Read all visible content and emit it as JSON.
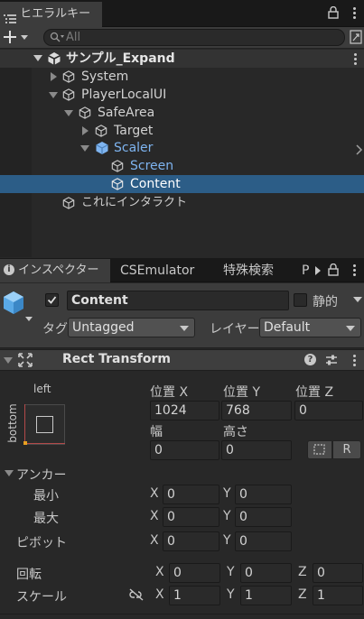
{
  "hierarchy": {
    "tab_label": "ヒエラルキー",
    "search_placeholder": "All",
    "scene_name": "サンプル_Expand",
    "items": [
      {
        "label": "System"
      },
      {
        "label": "PlayerLocalUI"
      },
      {
        "label": "SafeArea"
      },
      {
        "label": "Target"
      },
      {
        "label": "Scaler"
      },
      {
        "label": "Screen"
      },
      {
        "label": "Content"
      },
      {
        "label": "これにインタラクト"
      }
    ]
  },
  "inspector": {
    "tabs": [
      {
        "label": "インスペクター"
      },
      {
        "label": "CSEmulator"
      },
      {
        "label": "特殊検索"
      },
      {
        "label": "P"
      }
    ],
    "object_name": "Content",
    "static_label": "静的",
    "tag_label": "タグ",
    "tag_value": "Untagged",
    "layer_label": "レイヤー",
    "layer_value": "Default",
    "component_title": "Rect Transform",
    "anchor_preset": {
      "top_label": "left",
      "side_label": "bottom"
    },
    "pos_labels": [
      "位置 X",
      "位置 Y",
      "位置 Z"
    ],
    "pos_values": [
      "1024",
      "768",
      "0"
    ],
    "width_label": "幅",
    "height_label": "高さ",
    "width_value": "0",
    "height_value": "0",
    "r_button": "R",
    "anchors_label": "アンカー",
    "min_label": "最小",
    "max_label": "最大",
    "pivot_label": "ピボット",
    "rotation_label": "回転",
    "scale_label": "スケール",
    "axis_x": "X",
    "axis_y": "Y",
    "axis_z": "Z",
    "anchor_min": [
      "0",
      "0"
    ],
    "anchor_max": [
      "0",
      "0"
    ],
    "pivot": [
      "0",
      "0"
    ],
    "rotation": [
      "0",
      "0",
      "0"
    ],
    "scale": [
      "1",
      "1",
      "1"
    ]
  },
  "colors": {
    "selection": "#2c5d87",
    "prefab_blue": "#7eb4f0",
    "background": "#282828"
  }
}
